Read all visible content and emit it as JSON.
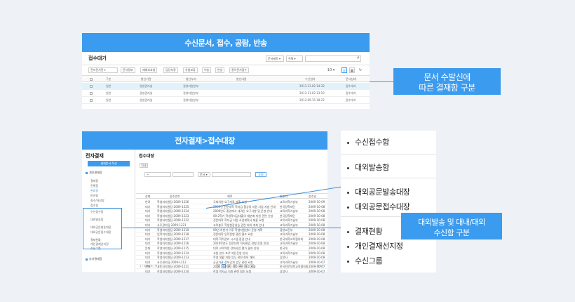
{
  "shot1": {
    "banner": "수신문서, 접수, 공람, 반송",
    "title": "접수대기",
    "search_select1": "문서제목 ▾",
    "search_select2": "전체 ▾",
    "toolbar": [
      "전자문서관 ▾",
      "문서정보",
      "재배부요청",
      "담당지정",
      "유첨보류",
      "이송",
      "반송",
      "종이문서접수"
    ],
    "page_size": "10 ▾",
    "columns": [
      "구분",
      "발신기관",
      "발신부서",
      "발신내용",
      "수신일자",
      "문서상태"
    ],
    "rows": [
      {
        "type": "일반",
        "org": "경영관리실",
        "dept": "경영지원본부",
        "date": "2013.11.02 14:33",
        "status": "접수대기"
      },
      {
        "type": "일반",
        "org": "경영관리실",
        "dept": "경영지원본부",
        "date": "2013.11.02 13:10",
        "status": "접수대기"
      },
      {
        "type": "일반",
        "org": "경영관리실",
        "dept": "경영지원본부",
        "date": "2013.09.15 18:23",
        "status": "접수대기"
      }
    ]
  },
  "callout1": {
    "line1": "문서 수발신에",
    "line2": "따른 결재함 구분"
  },
  "shot2": {
    "banner": "전자결재>접수대장",
    "side_title": "전자결재",
    "side_button": "결재문서 작성",
    "side_group1": "개인결재함",
    "side_items_a": [
      "결재함",
      "진행함",
      "완료함",
      "반려함",
      "회수/저장함",
      "참조함"
    ],
    "side_items_b": [
      "수신접수함",
      "대외발송함"
    ],
    "side_items_c": [
      "대외공문발송대장",
      "대외공문접수대장"
    ],
    "side_items_d": [
      "결재현황",
      "개인결재선지정",
      "수신그룹"
    ],
    "side_group2": "부서결재함",
    "main_title": "접수대장",
    "btn_print": "인쇄",
    "filter_date_from": "~",
    "filter_date_to": "",
    "filter_doc": "문서 ▾",
    "filter_search": "조회",
    "columns": [
      "상태",
      "접수번호",
      "제목",
      "발송처",
      "접수일"
    ],
    "rows": [
      [
        "반려",
        "학생처지원팀-2009-1226",
        "국회의원 요구자료 제출 요청",
        "교육과학기술부",
        "2009-10-09"
      ],
      [
        "대기",
        "학생처지원팀-2009-1225",
        "2009년 전문대학 학자금 협상의 지원 사업 지침 안내",
        "한국장학재단",
        "2009-10-08"
      ],
      [
        "대기",
        "학생처지원팀-2009-1224",
        "2009년도 중앙에서 내려온 요구사항 및 운영 안내",
        "교육과학기술부",
        "2009-10-08"
      ],
      [
        "대기",
        "학생처지원팀-2009-1223",
        "09.2학기 학생학자금대출의 재분배 지원 관련 신청",
        "한국장학재단",
        "2009-10-08"
      ],
      [
        "대기",
        "학생처지원팀-2009-1222",
        "전문대학 학자금 지원 사업계획서 제출 요청",
        "교육과학기술부",
        "2009-10-08"
      ],
      [
        "대기",
        "사무관리팀-2009-1221",
        "교육총무 학생현장실습 관련 회의 개최 안내",
        "교육과학기술부",
        "2009-10-08"
      ],
      [
        "대기",
        "학생처지원팀-2009-1219",
        "09년 하반기 이후 학생지원센터 운영 계획",
        "광양교진부",
        "2009-10-08"
      ],
      [
        "대기",
        "입학처지원팀-2009-1218",
        "전문대학 입학전형 관련 협조 요청",
        "교육과학기술부",
        "2009-10-08"
      ],
      [
        "대기",
        "학생처지원팀-2009-1217",
        "대학 학적관리 시스템 점검 안내",
        "한국대학교육협의회",
        "2009-10-08"
      ],
      [
        "대기",
        "학생처지원팀-2009-1216",
        "2010학년도 전문대학 학사편입 전형 운영 안내",
        "교육과학기술부",
        "2009-10-08"
      ],
      [
        "문화",
        "학생처지원팀-2009-1215",
        "대학 교육역량 강화사업 평가 결과 안내",
        "한국대",
        "2009-10-08"
      ],
      [
        "대기",
        "학생처지원팀-2009-1214",
        "교원 연수 프로그램 운영 안내",
        "교육과학기술부",
        "2009-10-08"
      ],
      [
        "대기",
        "학생처지원팀-2009-1213",
        "학생 생활 지원 업무 관련 회의 개최",
        "당양사",
        "2009-10-08"
      ],
      [
        "대기",
        "사무관리팀-2009-1212",
        "공공기관 정보공개 업무 관련 요청",
        "교육과학기술부",
        "2009-10-07"
      ],
      [
        "문화",
        "교무처지원팀-2009-1211",
        "2009 전문대학 평가 관련 자료 제출",
        "한국전문대학교육협의회",
        "2009-10-07"
      ],
      [
        "대기",
        "학생처지원팀-2009-1210",
        "학생 학자금 지원 관련 협조 요청",
        "당양사",
        "2009-10-07"
      ]
    ],
    "pages": [
      "<",
      "1",
      "2",
      "3",
      "4",
      "5",
      ">"
    ],
    "foot_left": "1 / 3 페이지 | 총 27",
    "foot_right": "보기 ▾"
  },
  "right_list": {
    "items": [
      "수신접수함",
      "대외발송함",
      "대외공문발송대장",
      "대외공문접수대장",
      "결재현황",
      "개인결재선지정",
      "수신그룹"
    ]
  },
  "callout2": {
    "line1": "대외발송 및 대내/대외",
    "line2": "수신함 구분"
  }
}
